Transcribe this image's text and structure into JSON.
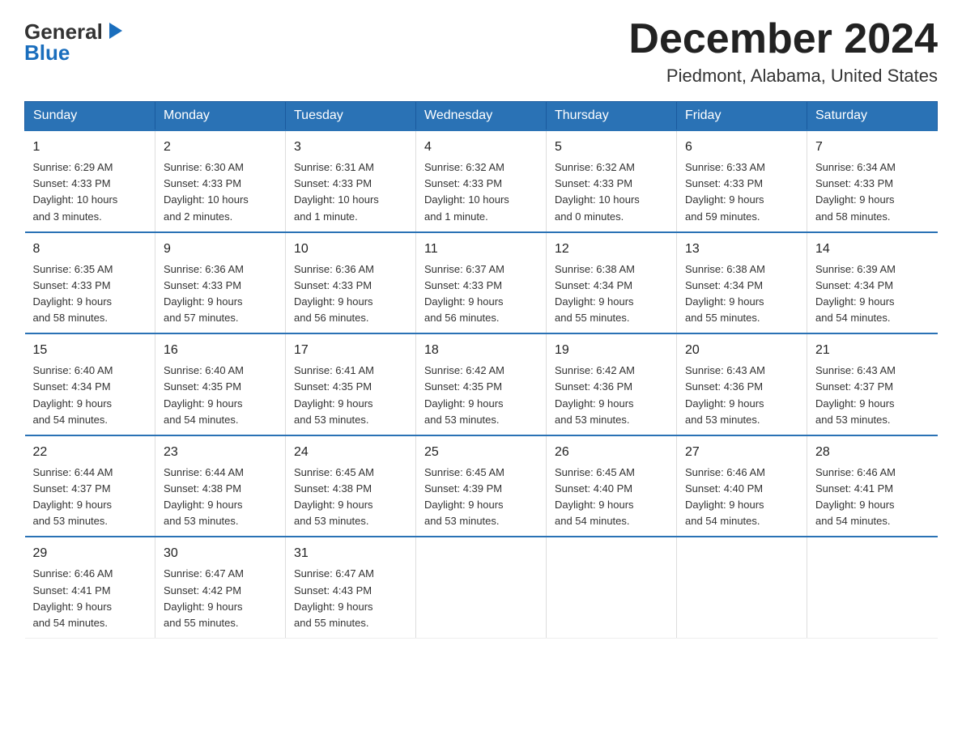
{
  "logo": {
    "text_general": "General",
    "text_blue": "Blue",
    "arrow_symbol": "▶"
  },
  "title": "December 2024",
  "subtitle": "Piedmont, Alabama, United States",
  "header_days": [
    "Sunday",
    "Monday",
    "Tuesday",
    "Wednesday",
    "Thursday",
    "Friday",
    "Saturday"
  ],
  "weeks": [
    [
      {
        "day": "1",
        "info": "Sunrise: 6:29 AM\nSunset: 4:33 PM\nDaylight: 10 hours\nand 3 minutes."
      },
      {
        "day": "2",
        "info": "Sunrise: 6:30 AM\nSunset: 4:33 PM\nDaylight: 10 hours\nand 2 minutes."
      },
      {
        "day": "3",
        "info": "Sunrise: 6:31 AM\nSunset: 4:33 PM\nDaylight: 10 hours\nand 1 minute."
      },
      {
        "day": "4",
        "info": "Sunrise: 6:32 AM\nSunset: 4:33 PM\nDaylight: 10 hours\nand 1 minute."
      },
      {
        "day": "5",
        "info": "Sunrise: 6:32 AM\nSunset: 4:33 PM\nDaylight: 10 hours\nand 0 minutes."
      },
      {
        "day": "6",
        "info": "Sunrise: 6:33 AM\nSunset: 4:33 PM\nDaylight: 9 hours\nand 59 minutes."
      },
      {
        "day": "7",
        "info": "Sunrise: 6:34 AM\nSunset: 4:33 PM\nDaylight: 9 hours\nand 58 minutes."
      }
    ],
    [
      {
        "day": "8",
        "info": "Sunrise: 6:35 AM\nSunset: 4:33 PM\nDaylight: 9 hours\nand 58 minutes."
      },
      {
        "day": "9",
        "info": "Sunrise: 6:36 AM\nSunset: 4:33 PM\nDaylight: 9 hours\nand 57 minutes."
      },
      {
        "day": "10",
        "info": "Sunrise: 6:36 AM\nSunset: 4:33 PM\nDaylight: 9 hours\nand 56 minutes."
      },
      {
        "day": "11",
        "info": "Sunrise: 6:37 AM\nSunset: 4:33 PM\nDaylight: 9 hours\nand 56 minutes."
      },
      {
        "day": "12",
        "info": "Sunrise: 6:38 AM\nSunset: 4:34 PM\nDaylight: 9 hours\nand 55 minutes."
      },
      {
        "day": "13",
        "info": "Sunrise: 6:38 AM\nSunset: 4:34 PM\nDaylight: 9 hours\nand 55 minutes."
      },
      {
        "day": "14",
        "info": "Sunrise: 6:39 AM\nSunset: 4:34 PM\nDaylight: 9 hours\nand 54 minutes."
      }
    ],
    [
      {
        "day": "15",
        "info": "Sunrise: 6:40 AM\nSunset: 4:34 PM\nDaylight: 9 hours\nand 54 minutes."
      },
      {
        "day": "16",
        "info": "Sunrise: 6:40 AM\nSunset: 4:35 PM\nDaylight: 9 hours\nand 54 minutes."
      },
      {
        "day": "17",
        "info": "Sunrise: 6:41 AM\nSunset: 4:35 PM\nDaylight: 9 hours\nand 53 minutes."
      },
      {
        "day": "18",
        "info": "Sunrise: 6:42 AM\nSunset: 4:35 PM\nDaylight: 9 hours\nand 53 minutes."
      },
      {
        "day": "19",
        "info": "Sunrise: 6:42 AM\nSunset: 4:36 PM\nDaylight: 9 hours\nand 53 minutes."
      },
      {
        "day": "20",
        "info": "Sunrise: 6:43 AM\nSunset: 4:36 PM\nDaylight: 9 hours\nand 53 minutes."
      },
      {
        "day": "21",
        "info": "Sunrise: 6:43 AM\nSunset: 4:37 PM\nDaylight: 9 hours\nand 53 minutes."
      }
    ],
    [
      {
        "day": "22",
        "info": "Sunrise: 6:44 AM\nSunset: 4:37 PM\nDaylight: 9 hours\nand 53 minutes."
      },
      {
        "day": "23",
        "info": "Sunrise: 6:44 AM\nSunset: 4:38 PM\nDaylight: 9 hours\nand 53 minutes."
      },
      {
        "day": "24",
        "info": "Sunrise: 6:45 AM\nSunset: 4:38 PM\nDaylight: 9 hours\nand 53 minutes."
      },
      {
        "day": "25",
        "info": "Sunrise: 6:45 AM\nSunset: 4:39 PM\nDaylight: 9 hours\nand 53 minutes."
      },
      {
        "day": "26",
        "info": "Sunrise: 6:45 AM\nSunset: 4:40 PM\nDaylight: 9 hours\nand 54 minutes."
      },
      {
        "day": "27",
        "info": "Sunrise: 6:46 AM\nSunset: 4:40 PM\nDaylight: 9 hours\nand 54 minutes."
      },
      {
        "day": "28",
        "info": "Sunrise: 6:46 AM\nSunset: 4:41 PM\nDaylight: 9 hours\nand 54 minutes."
      }
    ],
    [
      {
        "day": "29",
        "info": "Sunrise: 6:46 AM\nSunset: 4:41 PM\nDaylight: 9 hours\nand 54 minutes."
      },
      {
        "day": "30",
        "info": "Sunrise: 6:47 AM\nSunset: 4:42 PM\nDaylight: 9 hours\nand 55 minutes."
      },
      {
        "day": "31",
        "info": "Sunrise: 6:47 AM\nSunset: 4:43 PM\nDaylight: 9 hours\nand 55 minutes."
      },
      {
        "day": "",
        "info": ""
      },
      {
        "day": "",
        "info": ""
      },
      {
        "day": "",
        "info": ""
      },
      {
        "day": "",
        "info": ""
      }
    ]
  ]
}
